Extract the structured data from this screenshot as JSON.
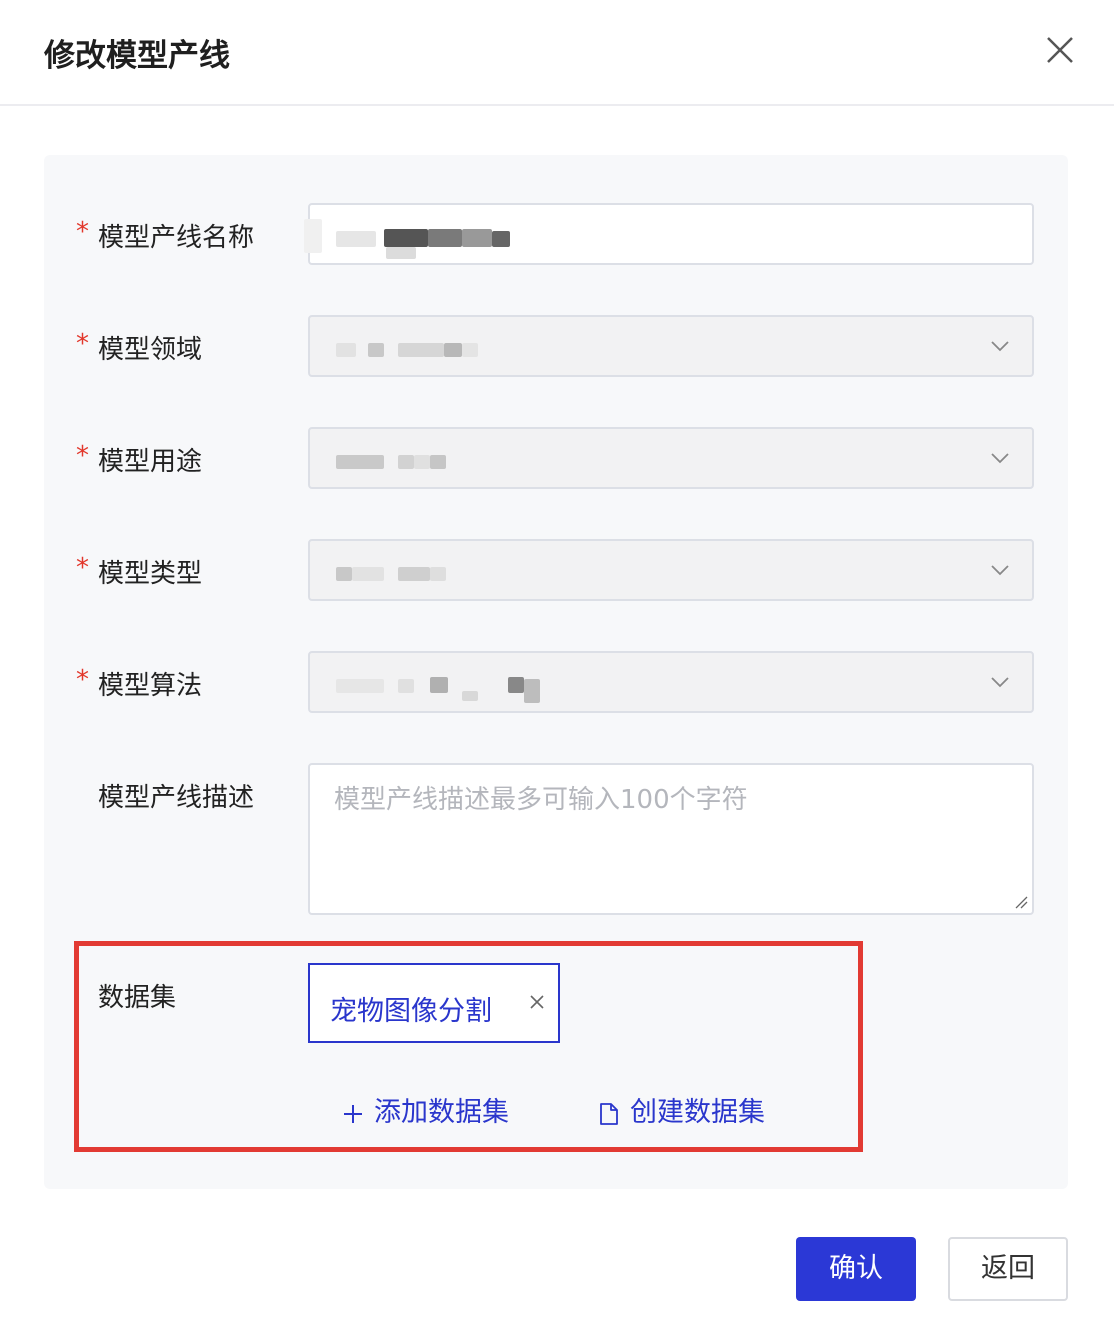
{
  "dialog": {
    "title": "修改模型产线",
    "close_icon": "close-icon"
  },
  "form": {
    "required_mark": "*",
    "fields": {
      "name": {
        "label": "模型产线名称"
      },
      "domain": {
        "label": "模型领域"
      },
      "usage": {
        "label": "模型用途"
      },
      "type": {
        "label": "模型类型"
      },
      "algorithm": {
        "label": "模型算法"
      },
      "description": {
        "label": "模型产线描述",
        "placeholder": "模型产线描述最多可输入100个字符"
      }
    },
    "dataset": {
      "label": "数据集",
      "selected": "宠物图像分割",
      "add_label": "添加数据集",
      "create_label": "创建数据集"
    }
  },
  "footer": {
    "confirm_label": "确认",
    "back_label": "返回"
  },
  "colors": {
    "accent": "#2b38d6",
    "required": "#e2372b",
    "highlight": "#e23a33"
  }
}
